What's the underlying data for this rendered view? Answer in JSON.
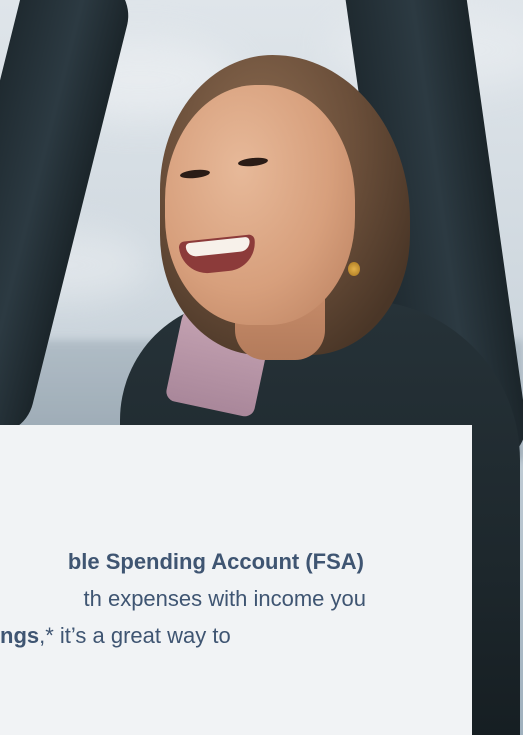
{
  "hero": {
    "image_alt": "Smiling woman in a wetsuit raising her arms outdoors by the sea"
  },
  "card": {
    "line1_bold": "ble Spending Account (FSA)",
    "line2": "th expenses with income you",
    "line3_bold": "ngs",
    "line3_rest": ",* it’s a great way to"
  },
  "colors": {
    "card_background": "#f1f3f5",
    "text": "#3f5572"
  }
}
